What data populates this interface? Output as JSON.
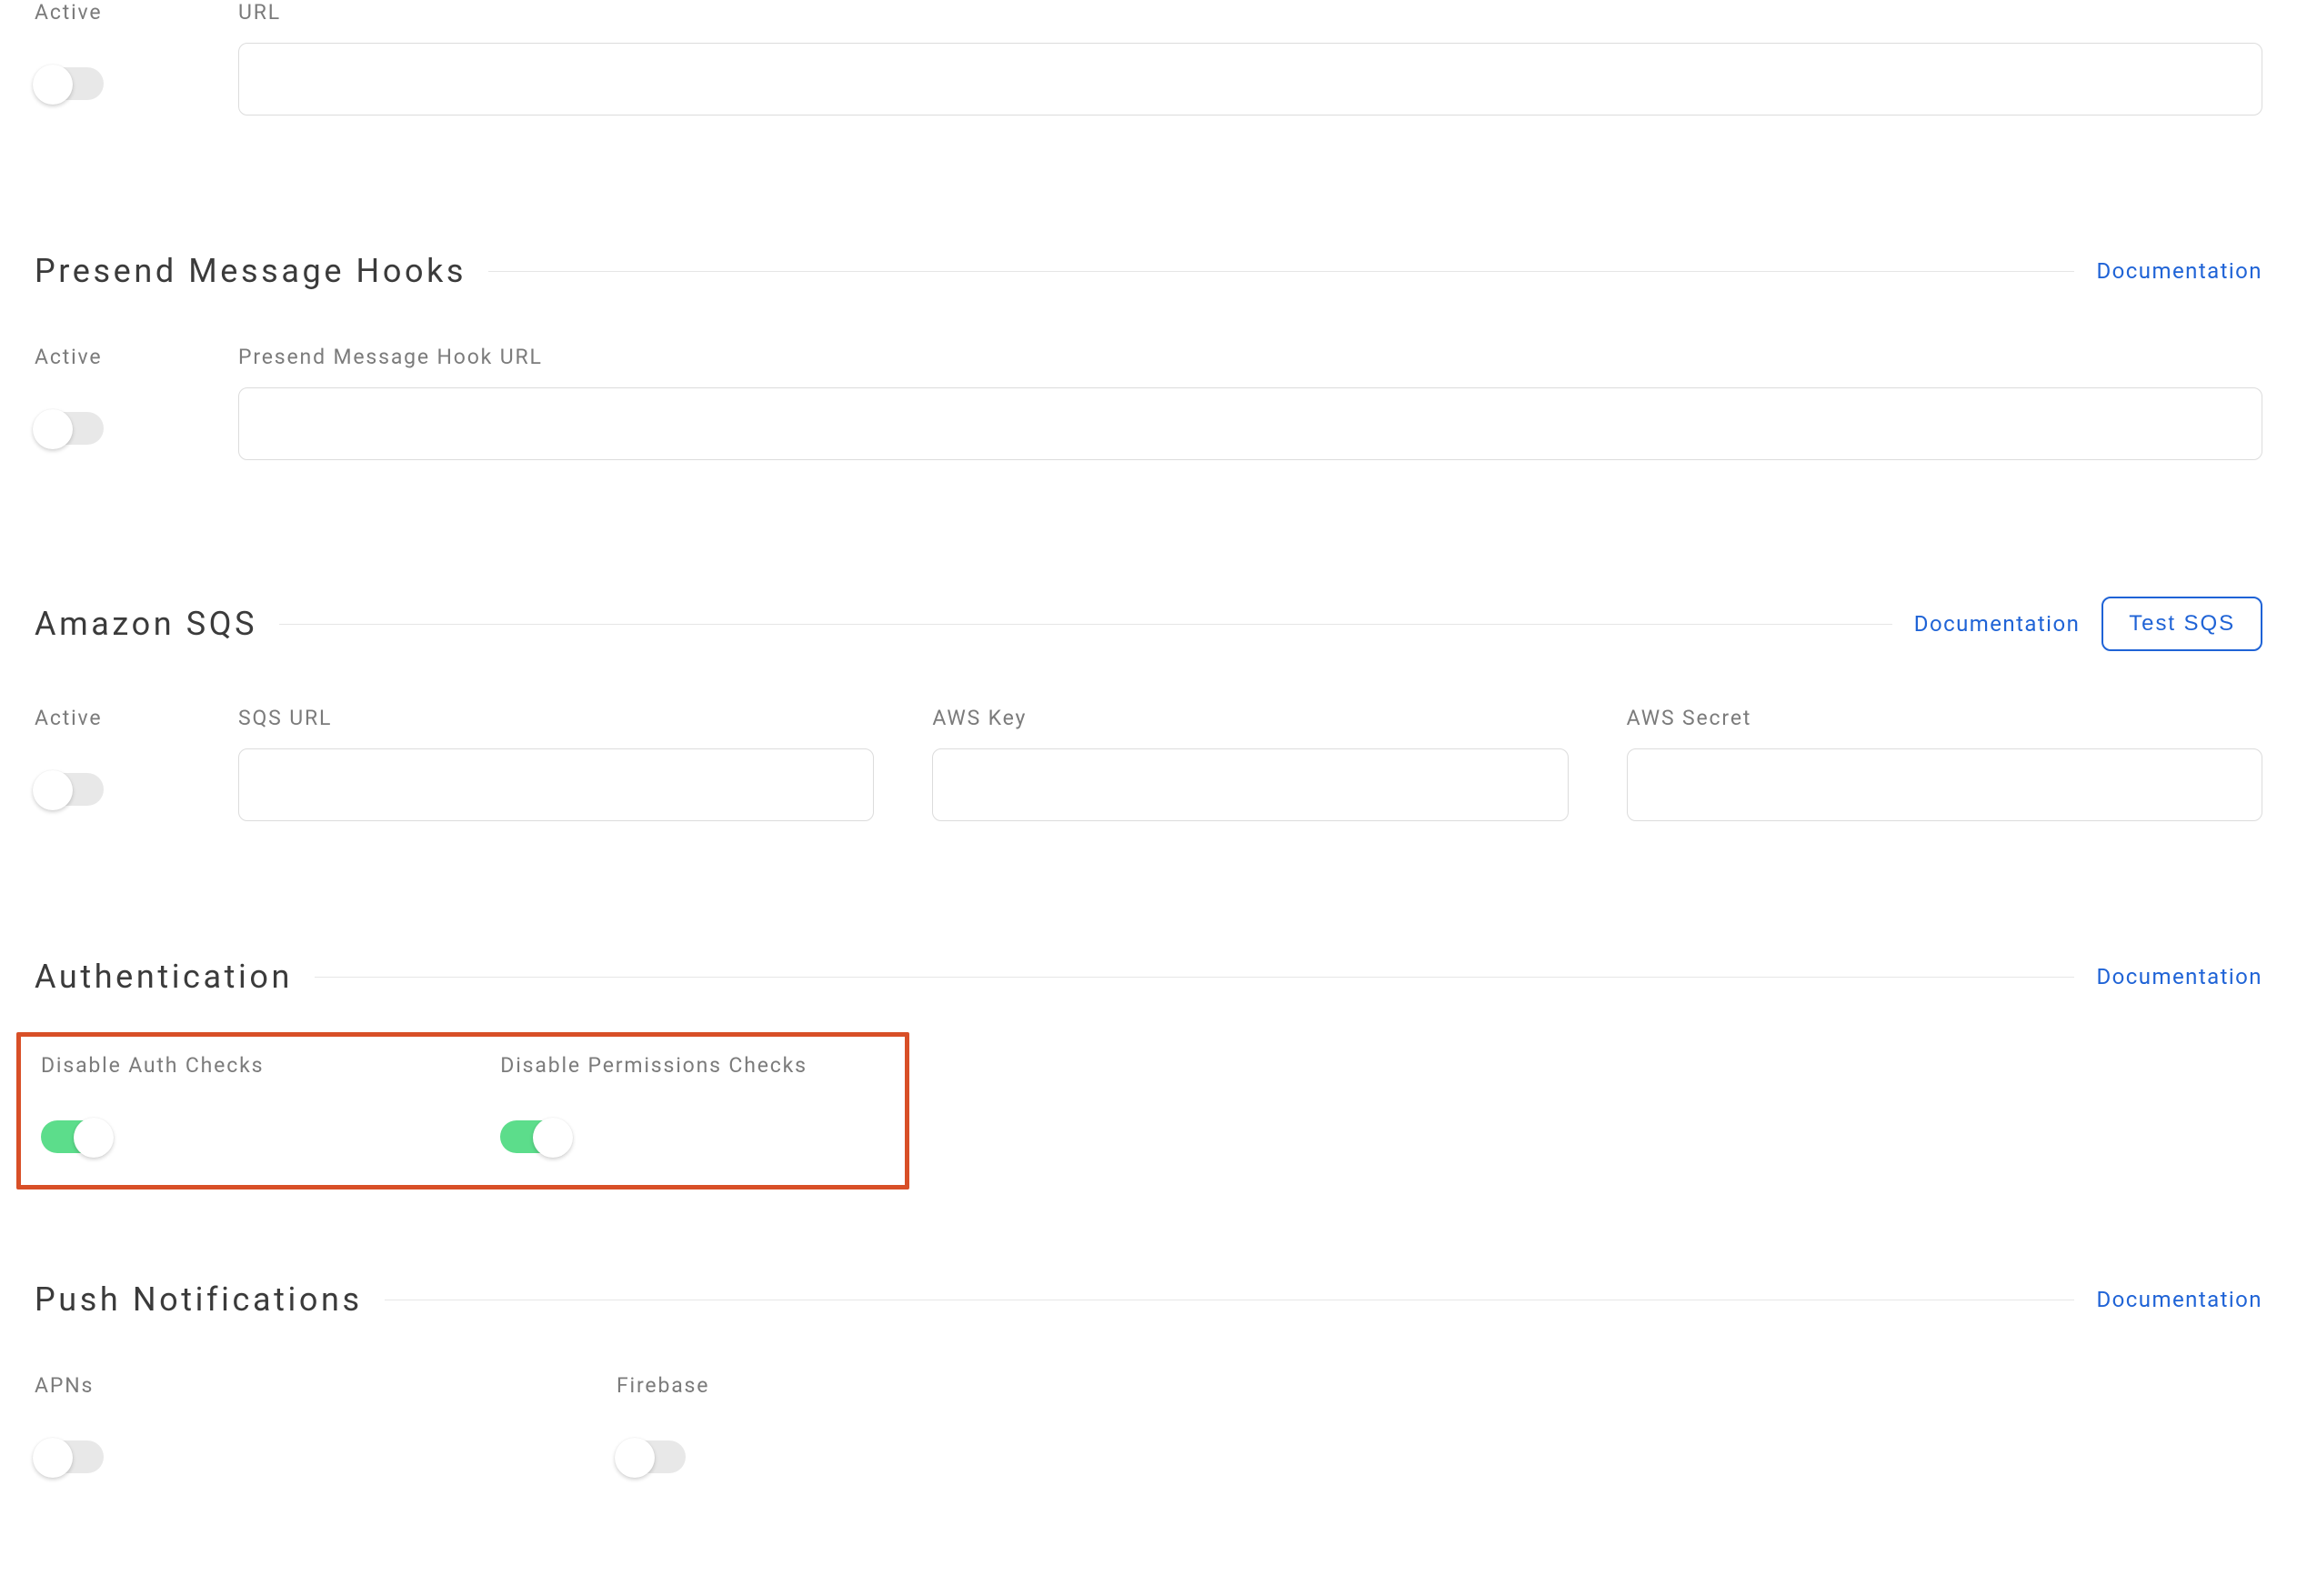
{
  "topRow": {
    "active_label": "Active",
    "active_on": false,
    "url_label": "URL",
    "url_value": ""
  },
  "presend": {
    "title": "Presend Message Hooks",
    "doc_label": "Documentation",
    "active_label": "Active",
    "active_on": false,
    "url_label": "Presend Message Hook URL",
    "url_value": ""
  },
  "sqs": {
    "title": "Amazon SQS",
    "doc_label": "Documentation",
    "test_label": "Test SQS",
    "active_label": "Active",
    "active_on": false,
    "url_label": "SQS URL",
    "url_value": "",
    "key_label": "AWS Key",
    "key_value": "",
    "secret_label": "AWS Secret",
    "secret_value": ""
  },
  "auth": {
    "title": "Authentication",
    "doc_label": "Documentation",
    "disable_auth_label": "Disable Auth Checks",
    "disable_auth_on": true,
    "disable_perm_label": "Disable Permissions Checks",
    "disable_perm_on": true
  },
  "push": {
    "title": "Push Notifications",
    "doc_label": "Documentation",
    "apns_label": "APNs",
    "apns_on": false,
    "firebase_label": "Firebase",
    "firebase_on": false
  }
}
